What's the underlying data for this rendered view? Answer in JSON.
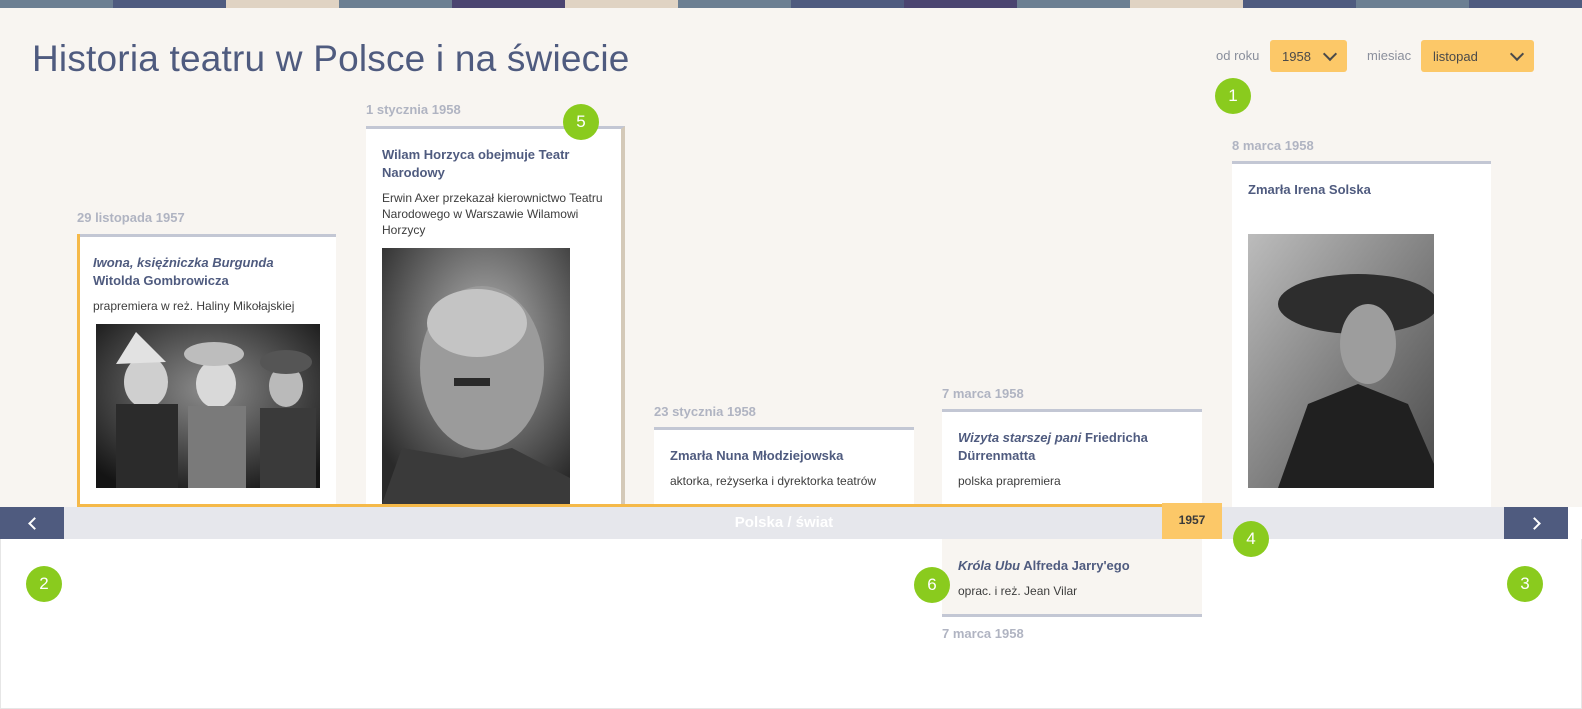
{
  "header": {
    "title": "Historia teatru w Polsce i na świecie",
    "year_filter_label": "od roku",
    "year_value": "1958",
    "month_filter_label": "miesiac",
    "month_value": "listopad"
  },
  "colors": {
    "stripes": [
      "#6c7f92",
      "#4f5b7f",
      "#e0d3c3",
      "#6c7f92",
      "#4b4470",
      "#e0d3c3",
      "#6c7f92",
      "#4f5b7f",
      "#4b4470",
      "#6c7f92",
      "#e0d3c3",
      "#4f5b7f",
      "#6c7f92",
      "#4f5b7f"
    ],
    "accent": "#fcc868",
    "marker": "#8acb1e",
    "nav": "#4f5b7f"
  },
  "events": [
    {
      "date": "29 listopada 1957",
      "title_italic": "Iwona, księżniczka Burgunda",
      "title_rest": " Witolda Gombrowicza",
      "text": "prapremiera w reż. Haliny Mikołajskiej",
      "image": "theatre-scene-photo"
    },
    {
      "date": "1 stycznia 1958",
      "title": "Wilam Horzyca obejmuje Teatr Narodowy",
      "text": "Erwin Axer przekazał kierownictwo Teatru Narodowego w Warszawie Wilamowi Horzycy",
      "image": "portrait-photo-man"
    },
    {
      "date": "23 stycznia 1958",
      "title": "Zmarła Nuna Młodziejowska",
      "text": "aktorka, reżyserka i dyrektorka teatrów"
    },
    {
      "date": "7 marca 1958",
      "title_italic": "Wizyta starszej pani",
      "title_rest": " Friedricha Dürrenmatta",
      "text": "polska prapremiera"
    },
    {
      "date": "8 marca 1958",
      "title": "Zmarła Irena Solska",
      "image": "portrait-photo-woman"
    }
  ],
  "world_events": [
    {
      "date": "7 marca 1958",
      "title_italic": "Króla Ubu",
      "title_rest": " Alfreda Jarry'ego",
      "text": "oprac. i reż. Jean Vilar"
    }
  ],
  "timeline": {
    "label": "Polska / świat",
    "current_year": "1957",
    "prev_icon": "chevron-left-icon",
    "next_icon": "chevron-right-icon"
  },
  "markers": [
    "1",
    "2",
    "3",
    "4",
    "5",
    "6"
  ]
}
